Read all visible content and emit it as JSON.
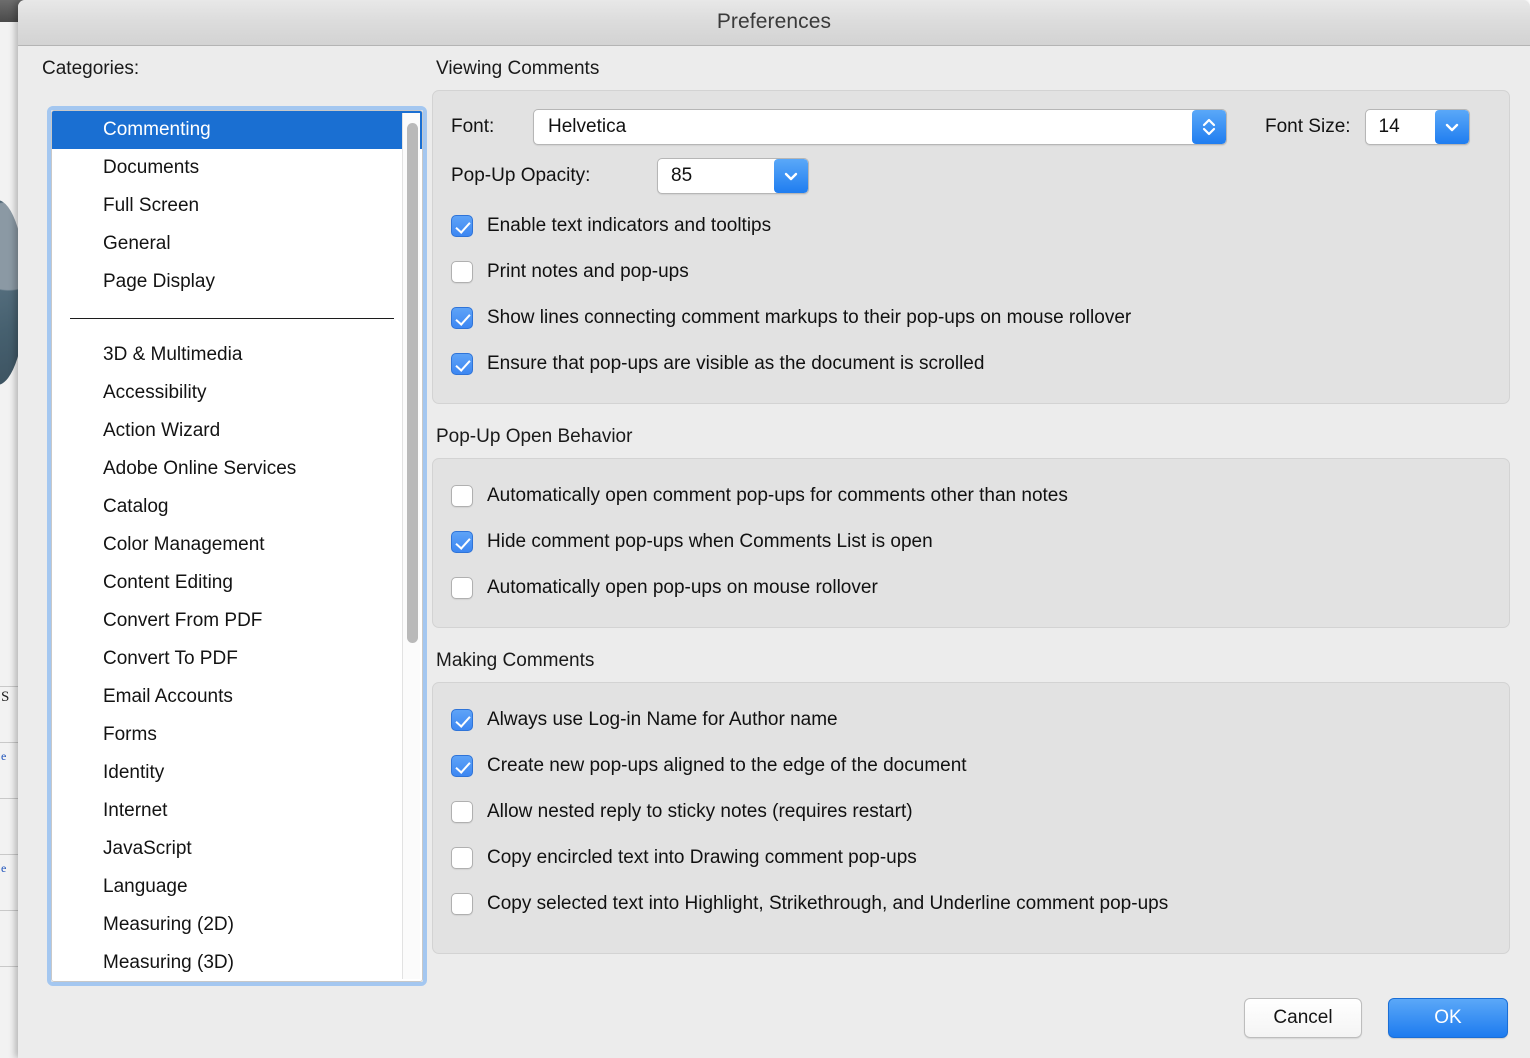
{
  "window": {
    "title": "Preferences"
  },
  "sidebar": {
    "label": "Categories:",
    "selected": "Commenting",
    "primary_items": [
      {
        "label": "Commenting",
        "selected": true
      },
      {
        "label": "Documents",
        "selected": false
      },
      {
        "label": "Full Screen",
        "selected": false
      },
      {
        "label": "General",
        "selected": false
      },
      {
        "label": "Page Display",
        "selected": false
      }
    ],
    "secondary_items": [
      {
        "label": "3D & Multimedia"
      },
      {
        "label": "Accessibility"
      },
      {
        "label": "Action Wizard"
      },
      {
        "label": "Adobe Online Services"
      },
      {
        "label": "Catalog"
      },
      {
        "label": "Color Management"
      },
      {
        "label": "Content Editing"
      },
      {
        "label": "Convert From PDF"
      },
      {
        "label": "Convert To PDF"
      },
      {
        "label": "Email Accounts"
      },
      {
        "label": "Forms"
      },
      {
        "label": "Identity"
      },
      {
        "label": "Internet"
      },
      {
        "label": "JavaScript"
      },
      {
        "label": "Language"
      },
      {
        "label": "Measuring (2D)"
      },
      {
        "label": "Measuring (3D)"
      }
    ]
  },
  "viewing_comments": {
    "title": "Viewing Comments",
    "font_label": "Font:",
    "font_value": "Helvetica",
    "font_size_label": "Font Size:",
    "font_size_value": "14",
    "opacity_label": "Pop-Up Opacity:",
    "opacity_value": "85",
    "checkboxes": [
      {
        "label": "Enable text indicators and tooltips",
        "checked": true
      },
      {
        "label": "Print notes and pop-ups",
        "checked": false
      },
      {
        "label": "Show lines connecting comment markups to their pop-ups on mouse rollover",
        "checked": true
      },
      {
        "label": "Ensure that pop-ups are visible as the document is scrolled",
        "checked": true
      }
    ]
  },
  "popup_open_behavior": {
    "title": "Pop-Up Open Behavior",
    "checkboxes": [
      {
        "label": "Automatically open comment pop-ups for comments other than notes",
        "checked": false
      },
      {
        "label": "Hide comment pop-ups when Comments List is open",
        "checked": true
      },
      {
        "label": "Automatically open pop-ups on mouse rollover",
        "checked": false
      }
    ]
  },
  "making_comments": {
    "title": "Making Comments",
    "checkboxes": [
      {
        "label": "Always use Log-in Name for Author name",
        "checked": true
      },
      {
        "label": "Create new pop-ups aligned to the edge of the document",
        "checked": true
      },
      {
        "label": "Allow nested reply to sticky notes (requires restart)",
        "checked": false
      },
      {
        "label": "Copy encircled text into Drawing comment pop-ups",
        "checked": false
      },
      {
        "label": "Copy selected text into Highlight, Strikethrough, and Underline comment pop-ups",
        "checked": false
      }
    ]
  },
  "footer": {
    "cancel_label": "Cancel",
    "ok_label": "OK"
  },
  "colors": {
    "selection_blue": "#1a6fd2",
    "accent_blue": "#1d7bef",
    "focus_ring": "#a4c7f0",
    "dialog_bg": "#ececec",
    "group_bg": "#e2e2e2"
  }
}
